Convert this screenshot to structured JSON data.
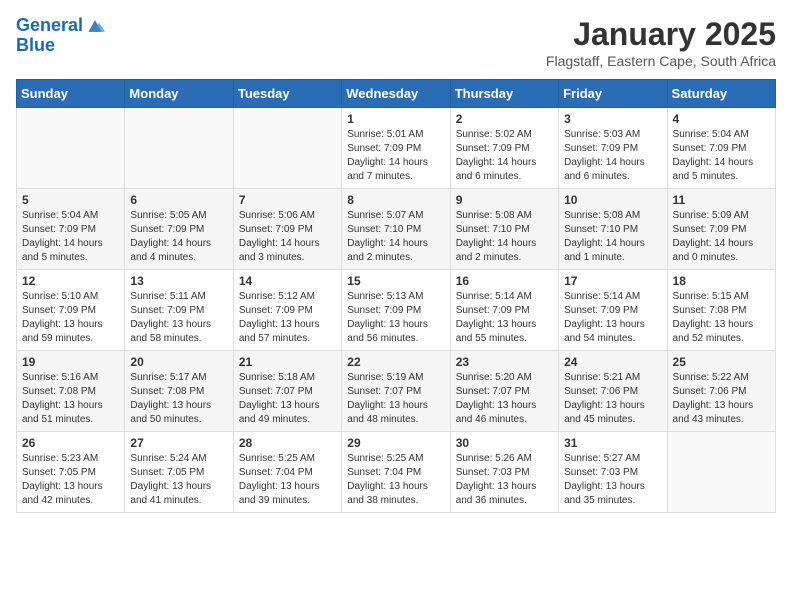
{
  "logo": {
    "line1": "General",
    "line2": "Blue"
  },
  "title": "January 2025",
  "subtitle": "Flagstaff, Eastern Cape, South Africa",
  "weekdays": [
    "Sunday",
    "Monday",
    "Tuesday",
    "Wednesday",
    "Thursday",
    "Friday",
    "Saturday"
  ],
  "weeks": [
    [
      {
        "day": "",
        "info": ""
      },
      {
        "day": "",
        "info": ""
      },
      {
        "day": "",
        "info": ""
      },
      {
        "day": "1",
        "info": "Sunrise: 5:01 AM\nSunset: 7:09 PM\nDaylight: 14 hours\nand 7 minutes."
      },
      {
        "day": "2",
        "info": "Sunrise: 5:02 AM\nSunset: 7:09 PM\nDaylight: 14 hours\nand 6 minutes."
      },
      {
        "day": "3",
        "info": "Sunrise: 5:03 AM\nSunset: 7:09 PM\nDaylight: 14 hours\nand 6 minutes."
      },
      {
        "day": "4",
        "info": "Sunrise: 5:04 AM\nSunset: 7:09 PM\nDaylight: 14 hours\nand 5 minutes."
      }
    ],
    [
      {
        "day": "5",
        "info": "Sunrise: 5:04 AM\nSunset: 7:09 PM\nDaylight: 14 hours\nand 5 minutes."
      },
      {
        "day": "6",
        "info": "Sunrise: 5:05 AM\nSunset: 7:09 PM\nDaylight: 14 hours\nand 4 minutes."
      },
      {
        "day": "7",
        "info": "Sunrise: 5:06 AM\nSunset: 7:09 PM\nDaylight: 14 hours\nand 3 minutes."
      },
      {
        "day": "8",
        "info": "Sunrise: 5:07 AM\nSunset: 7:10 PM\nDaylight: 14 hours\nand 2 minutes."
      },
      {
        "day": "9",
        "info": "Sunrise: 5:08 AM\nSunset: 7:10 PM\nDaylight: 14 hours\nand 2 minutes."
      },
      {
        "day": "10",
        "info": "Sunrise: 5:08 AM\nSunset: 7:10 PM\nDaylight: 14 hours\nand 1 minute."
      },
      {
        "day": "11",
        "info": "Sunrise: 5:09 AM\nSunset: 7:09 PM\nDaylight: 14 hours\nand 0 minutes."
      }
    ],
    [
      {
        "day": "12",
        "info": "Sunrise: 5:10 AM\nSunset: 7:09 PM\nDaylight: 13 hours\nand 59 minutes."
      },
      {
        "day": "13",
        "info": "Sunrise: 5:11 AM\nSunset: 7:09 PM\nDaylight: 13 hours\nand 58 minutes."
      },
      {
        "day": "14",
        "info": "Sunrise: 5:12 AM\nSunset: 7:09 PM\nDaylight: 13 hours\nand 57 minutes."
      },
      {
        "day": "15",
        "info": "Sunrise: 5:13 AM\nSunset: 7:09 PM\nDaylight: 13 hours\nand 56 minutes."
      },
      {
        "day": "16",
        "info": "Sunrise: 5:14 AM\nSunset: 7:09 PM\nDaylight: 13 hours\nand 55 minutes."
      },
      {
        "day": "17",
        "info": "Sunrise: 5:14 AM\nSunset: 7:09 PM\nDaylight: 13 hours\nand 54 minutes."
      },
      {
        "day": "18",
        "info": "Sunrise: 5:15 AM\nSunset: 7:08 PM\nDaylight: 13 hours\nand 52 minutes."
      }
    ],
    [
      {
        "day": "19",
        "info": "Sunrise: 5:16 AM\nSunset: 7:08 PM\nDaylight: 13 hours\nand 51 minutes."
      },
      {
        "day": "20",
        "info": "Sunrise: 5:17 AM\nSunset: 7:08 PM\nDaylight: 13 hours\nand 50 minutes."
      },
      {
        "day": "21",
        "info": "Sunrise: 5:18 AM\nSunset: 7:07 PM\nDaylight: 13 hours\nand 49 minutes."
      },
      {
        "day": "22",
        "info": "Sunrise: 5:19 AM\nSunset: 7:07 PM\nDaylight: 13 hours\nand 48 minutes."
      },
      {
        "day": "23",
        "info": "Sunrise: 5:20 AM\nSunset: 7:07 PM\nDaylight: 13 hours\nand 46 minutes."
      },
      {
        "day": "24",
        "info": "Sunrise: 5:21 AM\nSunset: 7:06 PM\nDaylight: 13 hours\nand 45 minutes."
      },
      {
        "day": "25",
        "info": "Sunrise: 5:22 AM\nSunset: 7:06 PM\nDaylight: 13 hours\nand 43 minutes."
      }
    ],
    [
      {
        "day": "26",
        "info": "Sunrise: 5:23 AM\nSunset: 7:05 PM\nDaylight: 13 hours\nand 42 minutes."
      },
      {
        "day": "27",
        "info": "Sunrise: 5:24 AM\nSunset: 7:05 PM\nDaylight: 13 hours\nand 41 minutes."
      },
      {
        "day": "28",
        "info": "Sunrise: 5:25 AM\nSunset: 7:04 PM\nDaylight: 13 hours\nand 39 minutes."
      },
      {
        "day": "29",
        "info": "Sunrise: 5:25 AM\nSunset: 7:04 PM\nDaylight: 13 hours\nand 38 minutes."
      },
      {
        "day": "30",
        "info": "Sunrise: 5:26 AM\nSunset: 7:03 PM\nDaylight: 13 hours\nand 36 minutes."
      },
      {
        "day": "31",
        "info": "Sunrise: 5:27 AM\nSunset: 7:03 PM\nDaylight: 13 hours\nand 35 minutes."
      },
      {
        "day": "",
        "info": ""
      }
    ]
  ]
}
